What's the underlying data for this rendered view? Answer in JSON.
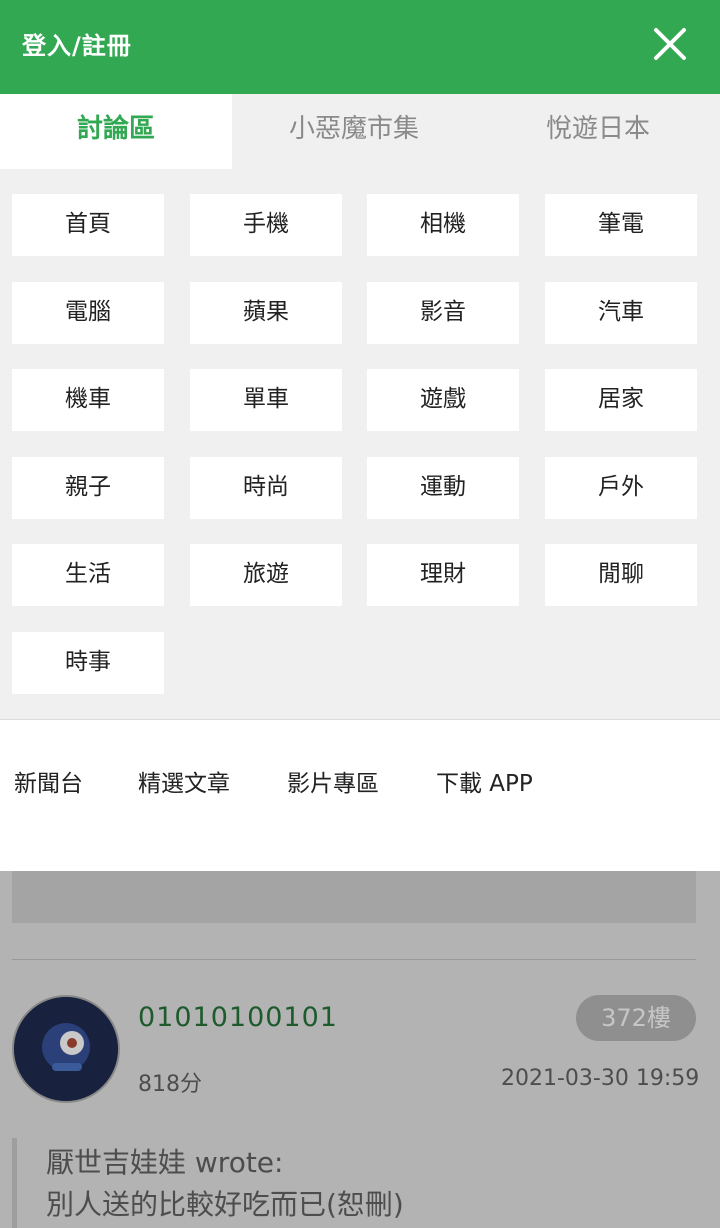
{
  "header": {
    "title": "登入/註冊",
    "close_icon": "close-icon"
  },
  "tabs": [
    {
      "label": "討論區",
      "active": true
    },
    {
      "label": "小惡魔市集",
      "active": false
    },
    {
      "label": "悅遊日本",
      "active": false
    }
  ],
  "categories": [
    "首頁",
    "手機",
    "相機",
    "筆電",
    "電腦",
    "蘋果",
    "影音",
    "汽車",
    "機車",
    "單車",
    "遊戲",
    "居家",
    "親子",
    "時尚",
    "運動",
    "戶外",
    "生活",
    "旅遊",
    "理財",
    "閒聊",
    "時事"
  ],
  "links": [
    "新聞台",
    "精選文章",
    "影片專區",
    "下載 APP"
  ],
  "post": {
    "username": "01010100101",
    "floor": "372樓",
    "score": "818分",
    "datetime": "2021-03-30 19:59",
    "quote_line1": "厭世吉娃娃 wrote:",
    "quote_line2": "別人送的比較好吃而已(恕刪)"
  },
  "colors": {
    "brand_green": "#33a853",
    "panel_bg": "#f0f0f0",
    "overlay_bg": "#b3b3b3"
  }
}
